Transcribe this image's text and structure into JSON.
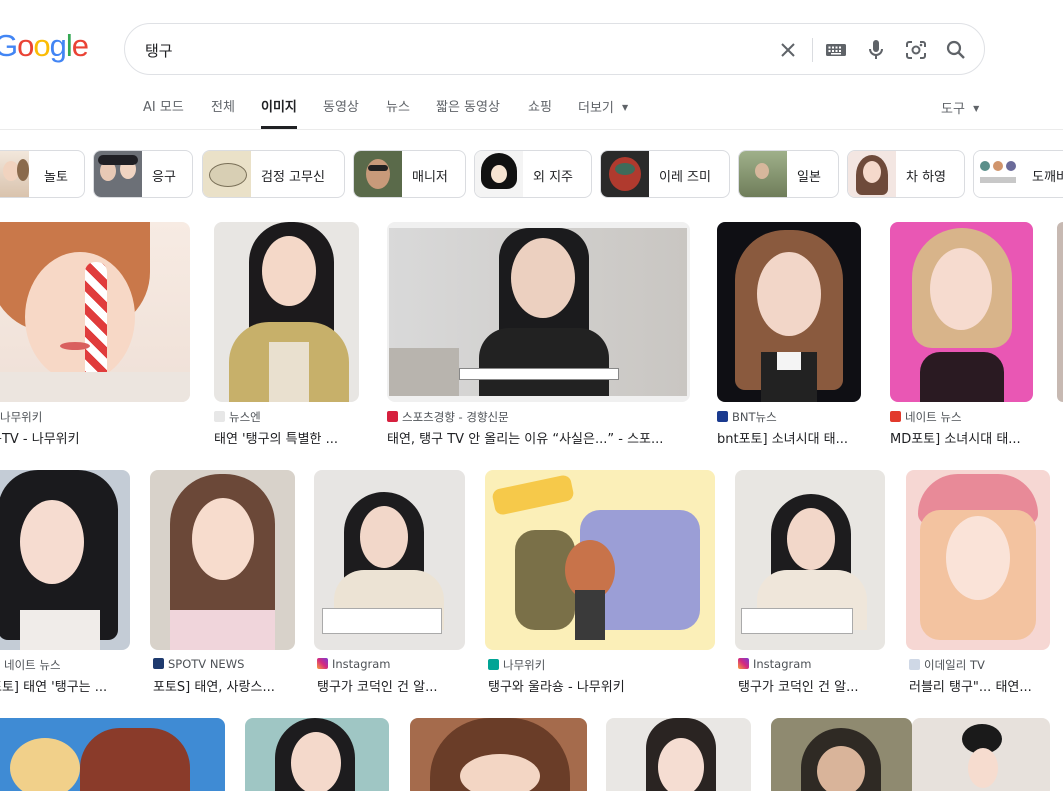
{
  "logo": "Google",
  "search": {
    "query": "탱구"
  },
  "tabs": [
    "AI 모드",
    "전체",
    "이미지",
    "동영상",
    "뉴스",
    "짧은 동영상",
    "쇼핑",
    "더보기"
  ],
  "tools_label": "도구",
  "chips": [
    "놀토",
    "응구",
    "검정 고무신",
    "매니저",
    "외 지주",
    "이레 즈미",
    "일본",
    "차 하영",
    "도깨비"
  ],
  "results": [
    {
      "source": "나무위키",
      "title": "구TV - 나무위키"
    },
    {
      "source": "뉴스엔",
      "title": "태연 '탱구의 특별한 ..."
    },
    {
      "source": "스포츠경향 - 경향신문",
      "title": "태연, 탱구 TV 안 올리는 이유 “사실은...” - 스포..."
    },
    {
      "source": "BNT뉴스",
      "title": "bnt포토] 소녀시대 태..."
    },
    {
      "source": "네이트 뉴스",
      "title": "MD포토] 소녀시대 태..."
    },
    {
      "source": "네이트 뉴스",
      "title": "포토] 태연 '탱구는 ..."
    },
    {
      "source": "SPOTV NEWS",
      "title": "포토S] 태연, 사랑스..."
    },
    {
      "source": "Instagram",
      "title": "탱구가 코덕인 건 알..."
    },
    {
      "source": "나무위키",
      "title": "탱구와 울라숑 - 나무위키"
    },
    {
      "source": "Instagram",
      "title": "탱구가 코덕인 건 알..."
    },
    {
      "source": "이데일리 TV",
      "title": "러블리 탱구\"... 태연..."
    }
  ],
  "colors": {
    "blue": "#4285F4",
    "red": "#EA4335",
    "yellow": "#FBBC05",
    "green": "#34A853"
  }
}
